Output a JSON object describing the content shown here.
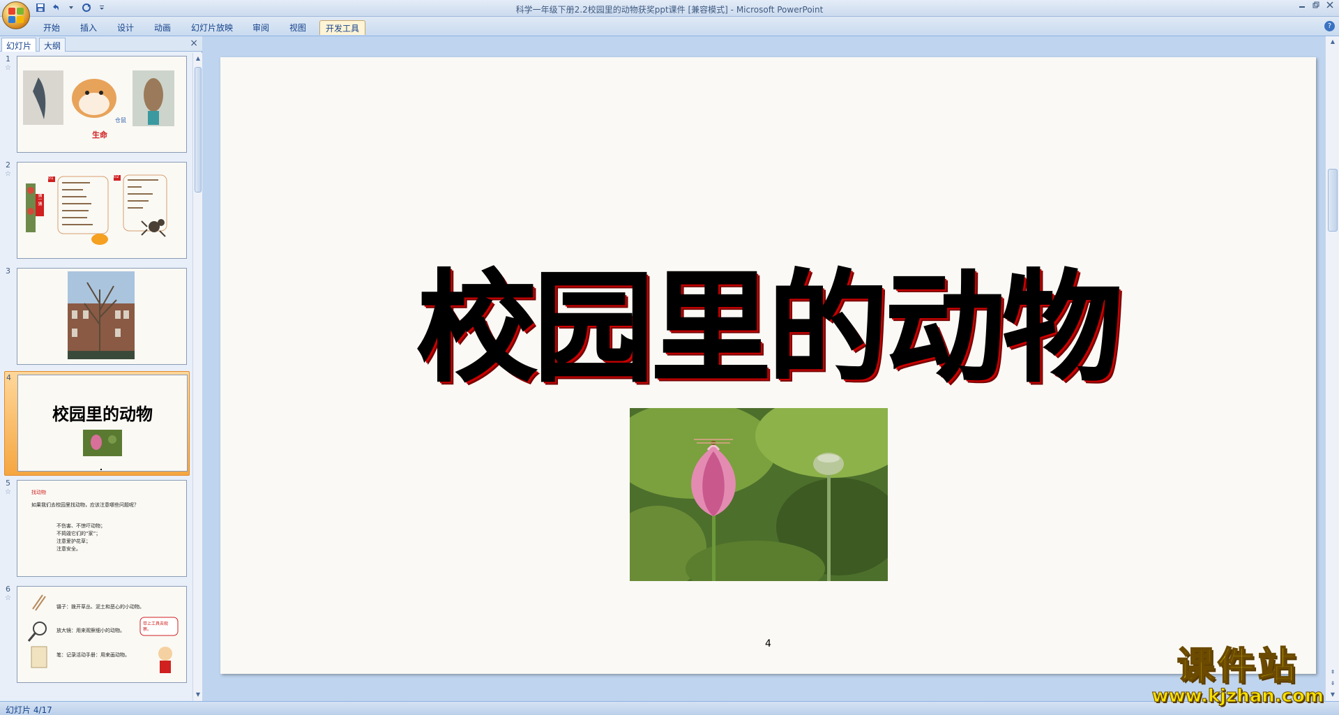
{
  "window": {
    "title": "科学一年级下册2.2校园里的动物获奖ppt课件 [兼容模式] - Microsoft PowerPoint"
  },
  "ribbon": {
    "tabs": [
      {
        "label": "开始"
      },
      {
        "label": "插入"
      },
      {
        "label": "设计"
      },
      {
        "label": "动画"
      },
      {
        "label": "幻灯片放映"
      },
      {
        "label": "审阅"
      },
      {
        "label": "视图"
      },
      {
        "label": "开发工具"
      }
    ],
    "active_tab": "开发工具"
  },
  "pane": {
    "tabs": [
      {
        "label": "幻灯片"
      },
      {
        "label": "大纲"
      }
    ],
    "close_icon": "×"
  },
  "thumbnails": [
    {
      "number": "1",
      "caption": "生命",
      "side_label": "仓鼠"
    },
    {
      "number": "2",
      "left_tag": "01",
      "right_tag": "02",
      "banner": "猜一猜"
    },
    {
      "number": "3"
    },
    {
      "number": "4",
      "title": "校园里的动物",
      "selected": true
    },
    {
      "number": "5",
      "head": "找动物",
      "line1": "如果我们去校园里找动物，应该注意哪些问题呢？",
      "line2": "不伤害、不惊吓动物；",
      "line3": "不捣毁它们的“家”；",
      "line4": "注意爱护花草；",
      "line5": "注意安全。"
    },
    {
      "number": "6",
      "row1": "镊子：拨开草丛、泥土和恶心的小动物。",
      "row2": "放大镜：用来观察细小的动物。",
      "row3": "笔：记录活动手册：用来画动物。",
      "bubble": "带上工具去观察。"
    }
  ],
  "slide": {
    "title": "校园里的动物",
    "page_number": "4"
  },
  "status": {
    "text": "幻灯片 4/17"
  },
  "watermark": {
    "brand": "课件站",
    "url": "www.kjzhan.com"
  },
  "colors": {
    "ribbon_bg": "#dfe9f5",
    "selected_slot": "#f5a640",
    "title_shadow": "#cc0000",
    "watermark": "#f7e200"
  }
}
